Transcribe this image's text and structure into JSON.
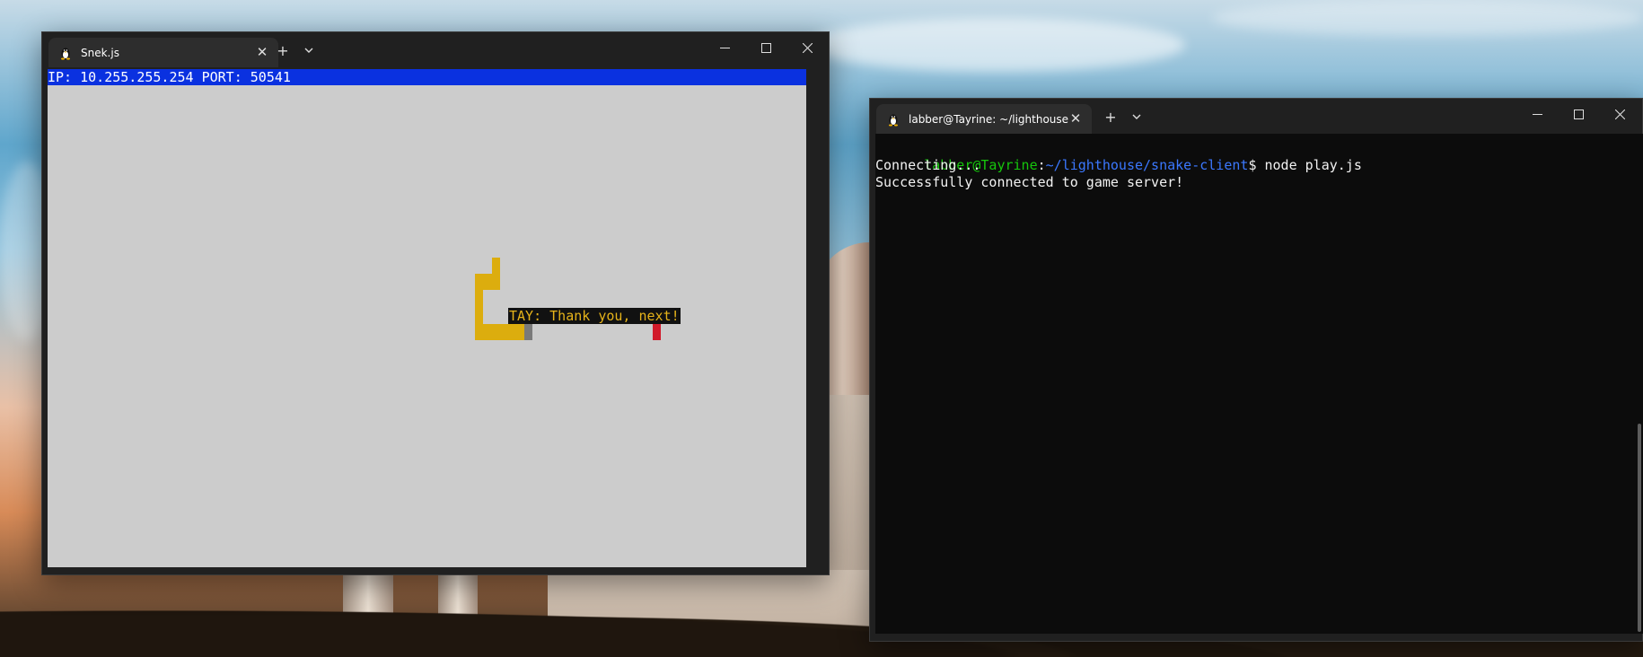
{
  "game_window": {
    "tab_title": "Snek.js",
    "status_bar": "IP: 10.255.255.254 PORT: 50541",
    "chat_message": "TAY: Thank you, next!"
  },
  "terminal_window": {
    "tab_title": "labber@Tayrine: ~/lighthouse",
    "prompt_user": "labber@Tayrine",
    "prompt_sep": ":",
    "prompt_path": "~/lighthouse/snake-client",
    "prompt_symbol": "$ ",
    "command": "node play.js",
    "output": [
      "Connecting...",
      "Successfully connected to game server!"
    ]
  },
  "icons": {
    "tab_icon": "tux-icon",
    "close_tab": "close-icon",
    "new_tab": "plus-icon",
    "dropdown": "chevron-down-icon",
    "minimize": "minimize-icon",
    "maximize": "maximize-icon",
    "close_window": "close-icon"
  },
  "colors": {
    "status_bar_bg": "#0a31e0",
    "snake": "#dcad0e",
    "food": "#d11a2a",
    "game_bg": "#cccccc",
    "terminal_bg": "#0c0c0c",
    "prompt_user": "#16c60c",
    "prompt_path": "#3b78ff"
  }
}
